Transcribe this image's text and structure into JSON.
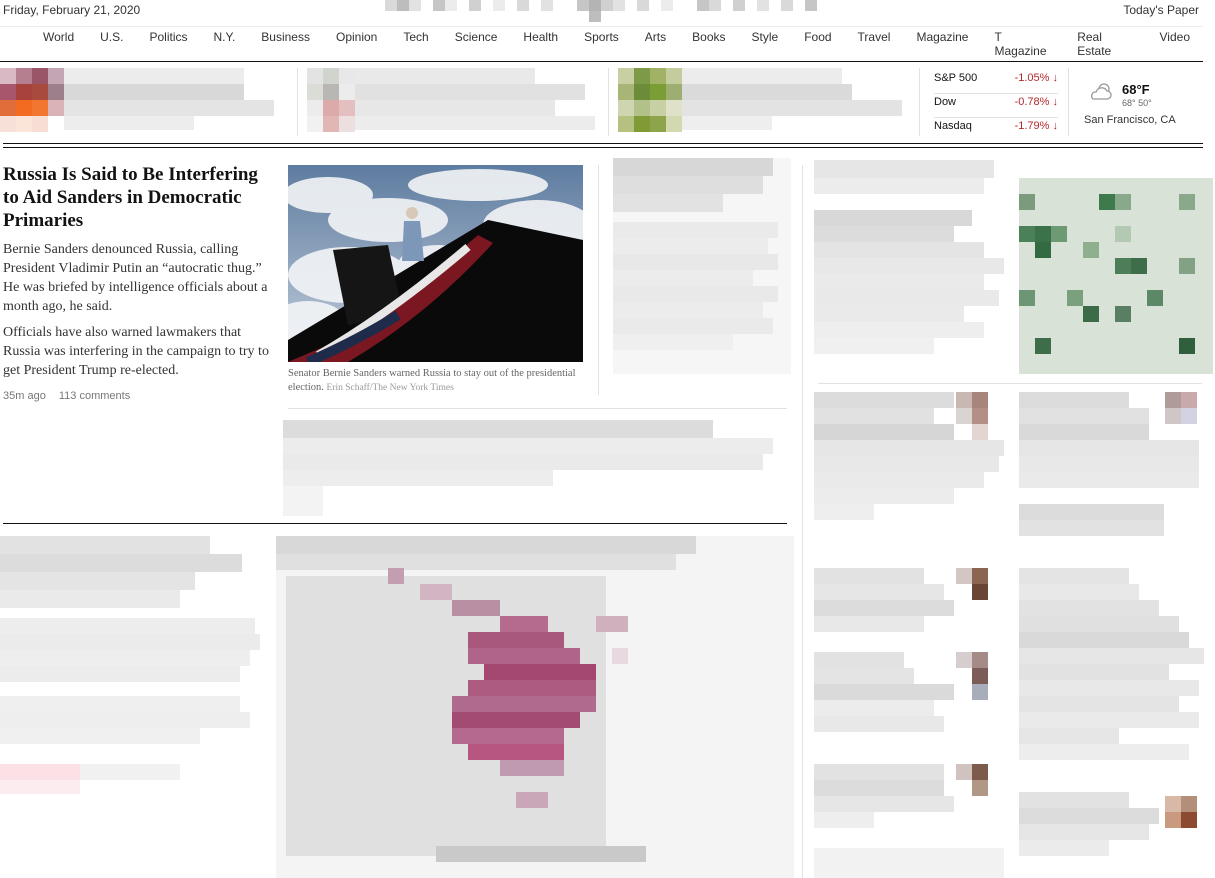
{
  "header": {
    "date": "Friday, February 21, 2020",
    "todays_paper": "Today's Paper"
  },
  "nav": {
    "items": [
      "World",
      "U.S.",
      "Politics",
      "N.Y.",
      "Business",
      "Opinion",
      "Tech",
      "Science",
      "Health",
      "Sports",
      "Arts",
      "Books",
      "Style",
      "Food",
      "Travel",
      "Magazine",
      "T Magazine",
      "Real Estate",
      "Video"
    ]
  },
  "markets": [
    {
      "name": "S&P 500",
      "change": "-1.05%",
      "direction": "down"
    },
    {
      "name": "Dow",
      "change": "-0.78%",
      "direction": "down"
    },
    {
      "name": "Nasdaq",
      "change": "-1.79%",
      "direction": "down"
    }
  ],
  "weather": {
    "icon": "partly-cloudy-icon",
    "temp": "68°F",
    "range": "68°  50°",
    "location": "San Francisco, CA"
  },
  "lead_story": {
    "headline": "Russia Is Said to Be Interfering to Aid Sanders in Democratic Primaries",
    "summary_1": "Bernie Sanders denounced Russia, calling President Vladimir Putin an “autocratic thug.” He was briefed by intelligence officials about a month ago, he said.",
    "summary_2": "Officials have also warned lawmakers that Russia was interfering in the campaign to try to get President Trump re-elected.",
    "time": "35m ago",
    "comments": "113 comments",
    "caption": "Senator Bernie Sanders warned Russia to stay out of the presidential election.",
    "credit": "Erin Schaff/The New York Times"
  },
  "colors": {
    "text": "#121212",
    "market_down": "#b3282d",
    "rule": "#e2e2e2"
  }
}
